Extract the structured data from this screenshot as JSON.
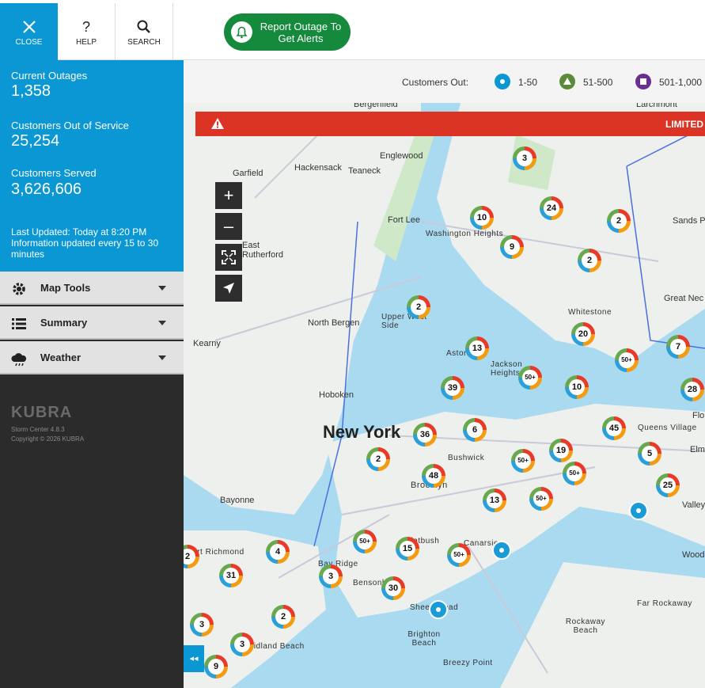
{
  "toolbar": {
    "close_label": "CLOSE",
    "help_label": "HELP",
    "search_label": "SEARCH",
    "report_label_1": "Report Outage To",
    "report_label_2": "Get Alerts"
  },
  "stats": {
    "current_outages_label": "Current Outages",
    "current_outages_value": "1,358",
    "customers_out_label": "Customers Out of Service",
    "customers_out_value": "25,254",
    "customers_served_label": "Customers Served",
    "customers_served_value": "3,626,606",
    "last_updated": "Last Updated: Today at 8:20 PM",
    "update_info": "Information updated every 15 to 30 minutes"
  },
  "accordions": [
    {
      "label": "Map Tools",
      "icon": "gear-icon"
    },
    {
      "label": "Summary",
      "icon": "list-icon"
    },
    {
      "label": "Weather",
      "icon": "cloud-icon"
    }
  ],
  "footer": {
    "brand": "KUBRA",
    "version": "Storm Center 4.8.3",
    "copyright": "Copyright © 2026 KUBRA"
  },
  "legend": {
    "label": "Customers Out:",
    "items": [
      {
        "label": "1-50",
        "color": "#0a97d3",
        "shape": "circle"
      },
      {
        "label": "51-500",
        "color": "#5a8a3a",
        "shape": "triangle"
      },
      {
        "label": "501-1,000",
        "color": "#6b2d8f",
        "shape": "square"
      }
    ]
  },
  "alert": {
    "text": "LIMITED"
  },
  "map_controls": {
    "zoom_in": "+",
    "zoom_out": "–"
  },
  "map_labels": {
    "new_york": "New York",
    "places": [
      "Bergenfield",
      "Larchmont",
      "Englewood",
      "Hackensack",
      "Teaneck",
      "Garfield",
      "Fort Lee",
      "Washington Heights",
      "East Rutherford",
      "Sands P",
      "Great Nec",
      "Whitestone",
      "Upper West Side",
      "Astoria",
      "Jackson Heights",
      "North Bergen",
      "Kearny",
      "Hoboken",
      "Bushwick",
      "Brooklyn",
      "Queens Village",
      "Bayonne",
      "Port Richmond",
      "Bay Ridge",
      "Bensonhurst",
      "Flatbush",
      "Canarsie",
      "Sheepshead",
      "Far Rockaway",
      "Rockaway Beach",
      "Brighton Beach",
      "Breezy Point",
      "Valley",
      "Wood",
      "Elm",
      "Flo",
      "Midland Beach"
    ]
  },
  "clusters": [
    "3",
    "24",
    "2",
    "10",
    "9",
    "2",
    "2",
    "20",
    "7",
    "13",
    "50+",
    "39",
    "10",
    "50+",
    "28",
    "36",
    "6",
    "45",
    "5",
    "2",
    "48",
    "19",
    "50+",
    "25",
    "50+",
    "13",
    "50+",
    "4",
    "50+",
    "15",
    "50+",
    "2",
    "31",
    "3",
    "30",
    "2",
    "3",
    "3",
    "9"
  ]
}
